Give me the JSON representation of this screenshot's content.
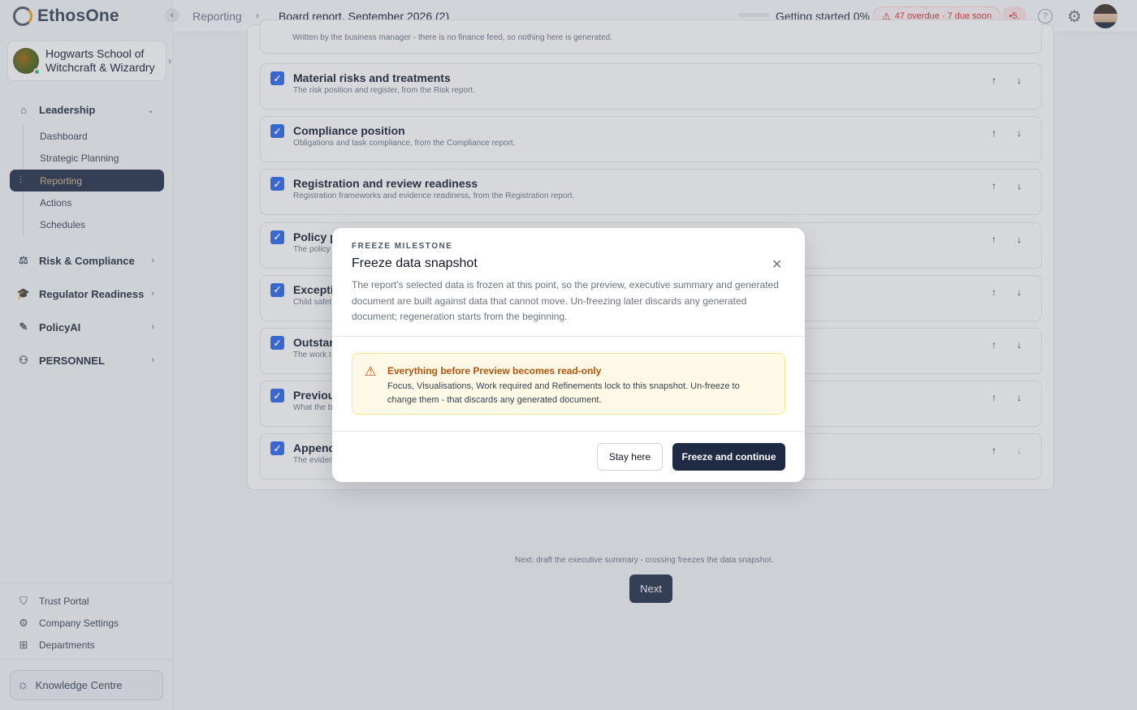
{
  "app": {
    "brand": "EthosOne"
  },
  "sidebar": {
    "school_line1": "Hogwarts School of",
    "school_line2": "Witchcraft & Wizardry",
    "leadership": "Leadership",
    "leadership_items": [
      "Dashboard",
      "Strategic Planning",
      "Reporting",
      "Actions",
      "Schedules"
    ],
    "risk": "Risk & Compliance",
    "regulator": "Regulator Readiness",
    "policyai": "PolicyAI",
    "personnel": "PERSONNEL",
    "footer_items": [
      "Trust Portal",
      "Company Settings",
      "Departments"
    ],
    "knowledge": "Knowledge Centre"
  },
  "header": {
    "crumb_parent": "Reporting",
    "crumb_current": "Board report, September 2026 (2)",
    "getting_started": "Getting started 0%",
    "getting_started_progress": 0,
    "alerts": "47 overdue · 7 due soon",
    "notifications": "5."
  },
  "main": {
    "top_caption": "Written by the business manager - there is no finance feed, so nothing here is generated.",
    "sections": [
      {
        "title": "Material risks and treatments",
        "desc": "The risk position and register, from the Risk report."
      },
      {
        "title": "Compliance position",
        "desc": "Obligations and task compliance, from the Compliance report."
      },
      {
        "title": "Registration and review readiness",
        "desc": "Registration frameworks and evidence readiness, from the Registration report."
      },
      {
        "title": "Policy p",
        "desc": "The policy"
      },
      {
        "title": "Excepti",
        "desc": "Child safet"
      },
      {
        "title": "Outstar",
        "desc": "The work t"
      },
      {
        "title": "Previou",
        "desc": "What the b"
      },
      {
        "title": "Append",
        "desc": "The eviden"
      }
    ],
    "next_note": "Next: draft the executive summary - crossing freezes the data snapshot.",
    "next_label": "Next"
  },
  "modal": {
    "eyebrow": "FREEZE MILESTONE",
    "title": "Freeze data snapshot",
    "body": "The report's selected data is frozen at this point, so the preview, executive summary and generated document are built against data that cannot move. Un-freezing later discards any generated document; regeneration starts from the beginning.",
    "warning_title": "Everything before Preview becomes read-only",
    "warning_text": "Focus, Visualisations, Work required and Refinements lock to this snapshot. Un-freeze to change them - that discards any generated document.",
    "stay_label": "Stay here",
    "freeze_label": "Freeze and continue"
  },
  "colors": {
    "navy": "#1f2a44",
    "accent_gold": "#d6b98c",
    "checkbox_blue": "#2563eb",
    "warning": "#b45309",
    "alert_red": "#dc2626"
  }
}
